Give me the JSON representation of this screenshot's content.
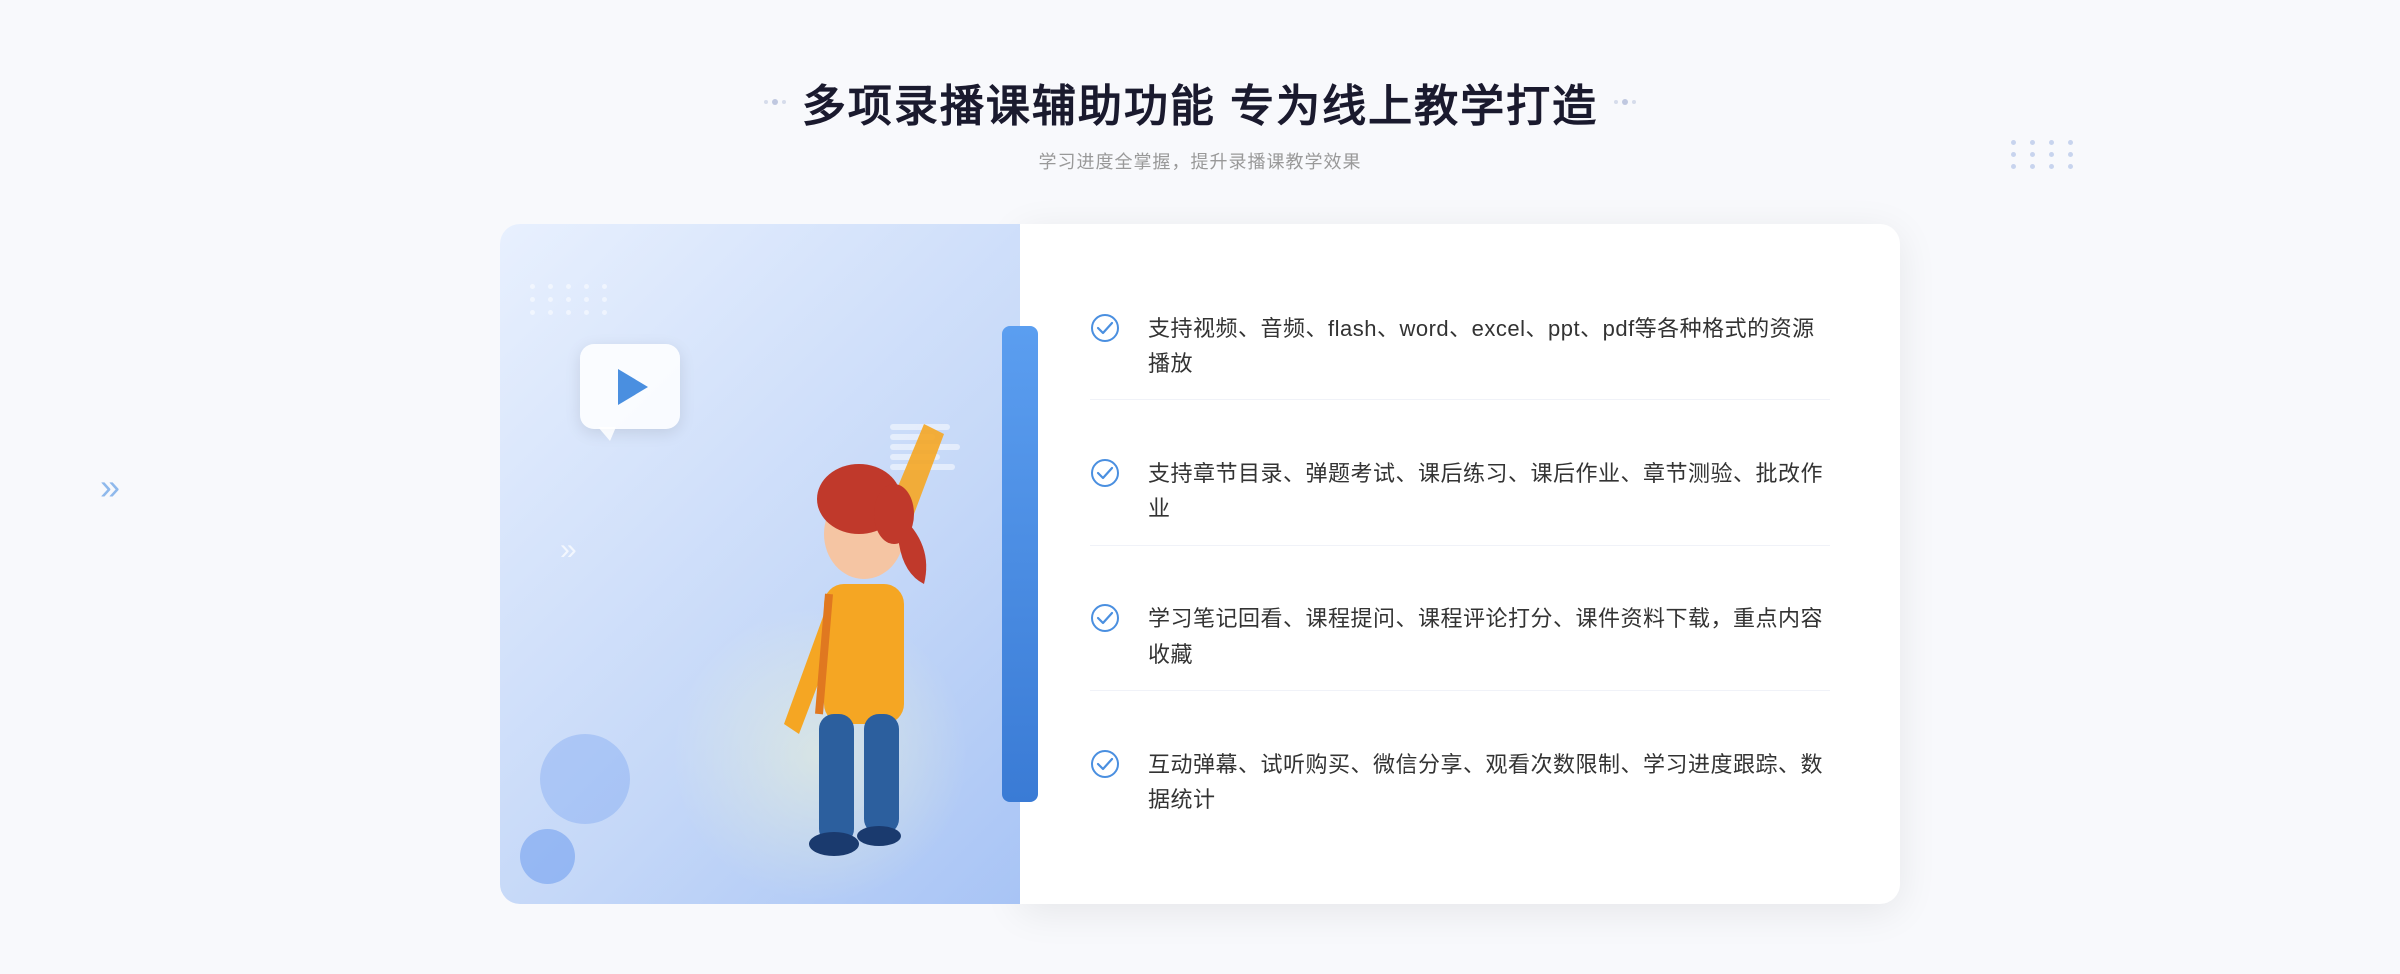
{
  "page": {
    "background_color": "#f5f7fb"
  },
  "header": {
    "title": "多项录播课辅助功能 专为线上教学打造",
    "subtitle": "学习进度全掌握，提升录播课教学效果",
    "decorator_left": "❋",
    "decorator_right": "❋"
  },
  "features": [
    {
      "id": 1,
      "text": "支持视频、音频、flash、word、excel、ppt、pdf等各种格式的资源播放"
    },
    {
      "id": 2,
      "text": "支持章节目录、弹题考试、课后练习、课后作业、章节测验、批改作业"
    },
    {
      "id": 3,
      "text": "学习笔记回看、课程提问、课程评论打分、课件资料下载，重点内容收藏"
    },
    {
      "id": 4,
      "text": "互动弹幕、试听购买、微信分享、观看次数限制、学习进度跟踪、数据统计"
    }
  ],
  "chevron": {
    "symbol": "»"
  },
  "colors": {
    "primary_blue": "#4a8fe0",
    "light_blue": "#e8f0fe",
    "text_dark": "#1a1a2e",
    "text_gray": "#999999",
    "text_body": "#333333",
    "check_color": "#4a8fe0"
  }
}
